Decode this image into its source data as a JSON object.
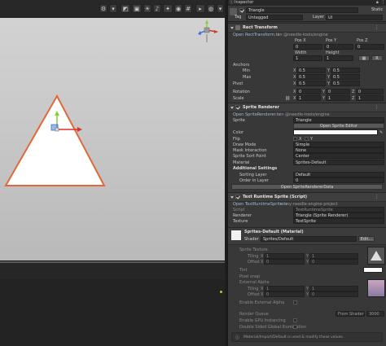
{
  "inspector": {
    "tab_title": "Inspector",
    "object_name": "Triangle",
    "static_label": "Static",
    "tag_label": "Tag",
    "tag_value": "Untagged",
    "layer_label": "Layer",
    "layer_value": "UI"
  },
  "rect_transform": {
    "title": "Rect Transform",
    "open_link": "Open RectTransform.ts",
    "source": "in @needle-tools/engine",
    "pos_x_label": "Pos X",
    "pos_y_label": "Pos Y",
    "pos_z_label": "Pos Z",
    "pos_x": "0",
    "pos_y": "0",
    "pos_z": "0",
    "width_label": "Width",
    "height_label": "Height",
    "width": "1",
    "height": "1",
    "anchors_label": "Anchors",
    "min_label": "Min",
    "max_label": "Max",
    "min_x": "0.5",
    "min_y": "0.5",
    "max_x": "0.5",
    "max_y": "0.5",
    "pivot_label": "Pivot",
    "pivot_x": "0.5",
    "pivot_y": "0.5",
    "rotation_label": "Rotation",
    "rot_x": "0",
    "rot_y": "0",
    "rot_z": "0",
    "scale_label": "Scale",
    "scale_x": "1",
    "scale_y": "1",
    "scale_z": "1"
  },
  "sprite_renderer": {
    "title": "Sprite Renderer",
    "open_link": "Open SpriteRenderer.ts",
    "source": "in @needle-tools/engine",
    "sprite_label": "Sprite",
    "sprite_value": "Triangle",
    "open_editor_label": "Open Sprite Editor",
    "color_label": "Color",
    "flip_label": "Flip",
    "flip_x": "X",
    "flip_y": "Y",
    "draw_mode_label": "Draw Mode",
    "draw_mode_value": "Simple",
    "mask_label": "Mask Interaction",
    "mask_value": "None",
    "sort_point_label": "Sprite Sort Point",
    "sort_point_value": "Center",
    "material_label": "Material",
    "material_value": "Sprites-Default",
    "additional_label": "Additional Settings",
    "sorting_layer_label": "Sorting Layer",
    "sorting_layer_value": "Default",
    "order_label": "Order in Layer",
    "order_value": "0",
    "renderer_data_label": "Open SpriteRendererData"
  },
  "text_runtime": {
    "title": "Text Runtime Sprite (Script)",
    "open_link": "Open TextRuntimeSprite.ts",
    "source": "in my-needle-engine-project",
    "script_label": "Script",
    "script_value": "TextRuntimeSprite",
    "renderer_label": "Renderer",
    "renderer_value": "Triangle (Sprite Renderer)",
    "texture_label": "Texture",
    "texture_value": "TextSprite"
  },
  "material": {
    "title": "Sprites-Default (Material)",
    "shader_label": "Shader",
    "shader_value": "Sprites/Default",
    "edit_label": "Edit...",
    "sprite_texture_label": "Sprite Texture",
    "tiling_label": "Tiling",
    "offset_label": "Offset",
    "tiling_x": "1",
    "tiling_y": "1",
    "offset_x": "0",
    "offset_y": "0",
    "tint_label": "Tint",
    "pixel_snap_label": "Pixel snap",
    "external_alpha_label": "External Alpha",
    "tiling2_x": "1",
    "tiling2_y": "1",
    "offset2_x": "0",
    "offset2_y": "0",
    "enable_external_alpha_label": "Enable External Alpha",
    "render_queue_label": "Render Queue",
    "render_queue_mode": "From Shader",
    "render_queue_value": "3000",
    "gpu_instancing_label": "Enable GPU Instancing",
    "double_sided_label": "Double Sided Global Illumination",
    "footer_note": "Material/Import/Default is used & modify these values."
  },
  "colors": {
    "accent": "#4d8fd6",
    "triangle_fill": "#ffffff",
    "triangle_outline": "#e0683a",
    "gizmo_y": "#8bcf3a",
    "gizmo_x": "#d9322a",
    "gizmo_z": "#3a6fd9"
  },
  "icons": [
    "gear-icon",
    "cube-icon",
    "lock-icon",
    "menu-icon",
    "scene-gizmo-icon",
    "script-icon",
    "sprite-icon",
    "material-icon"
  ]
}
